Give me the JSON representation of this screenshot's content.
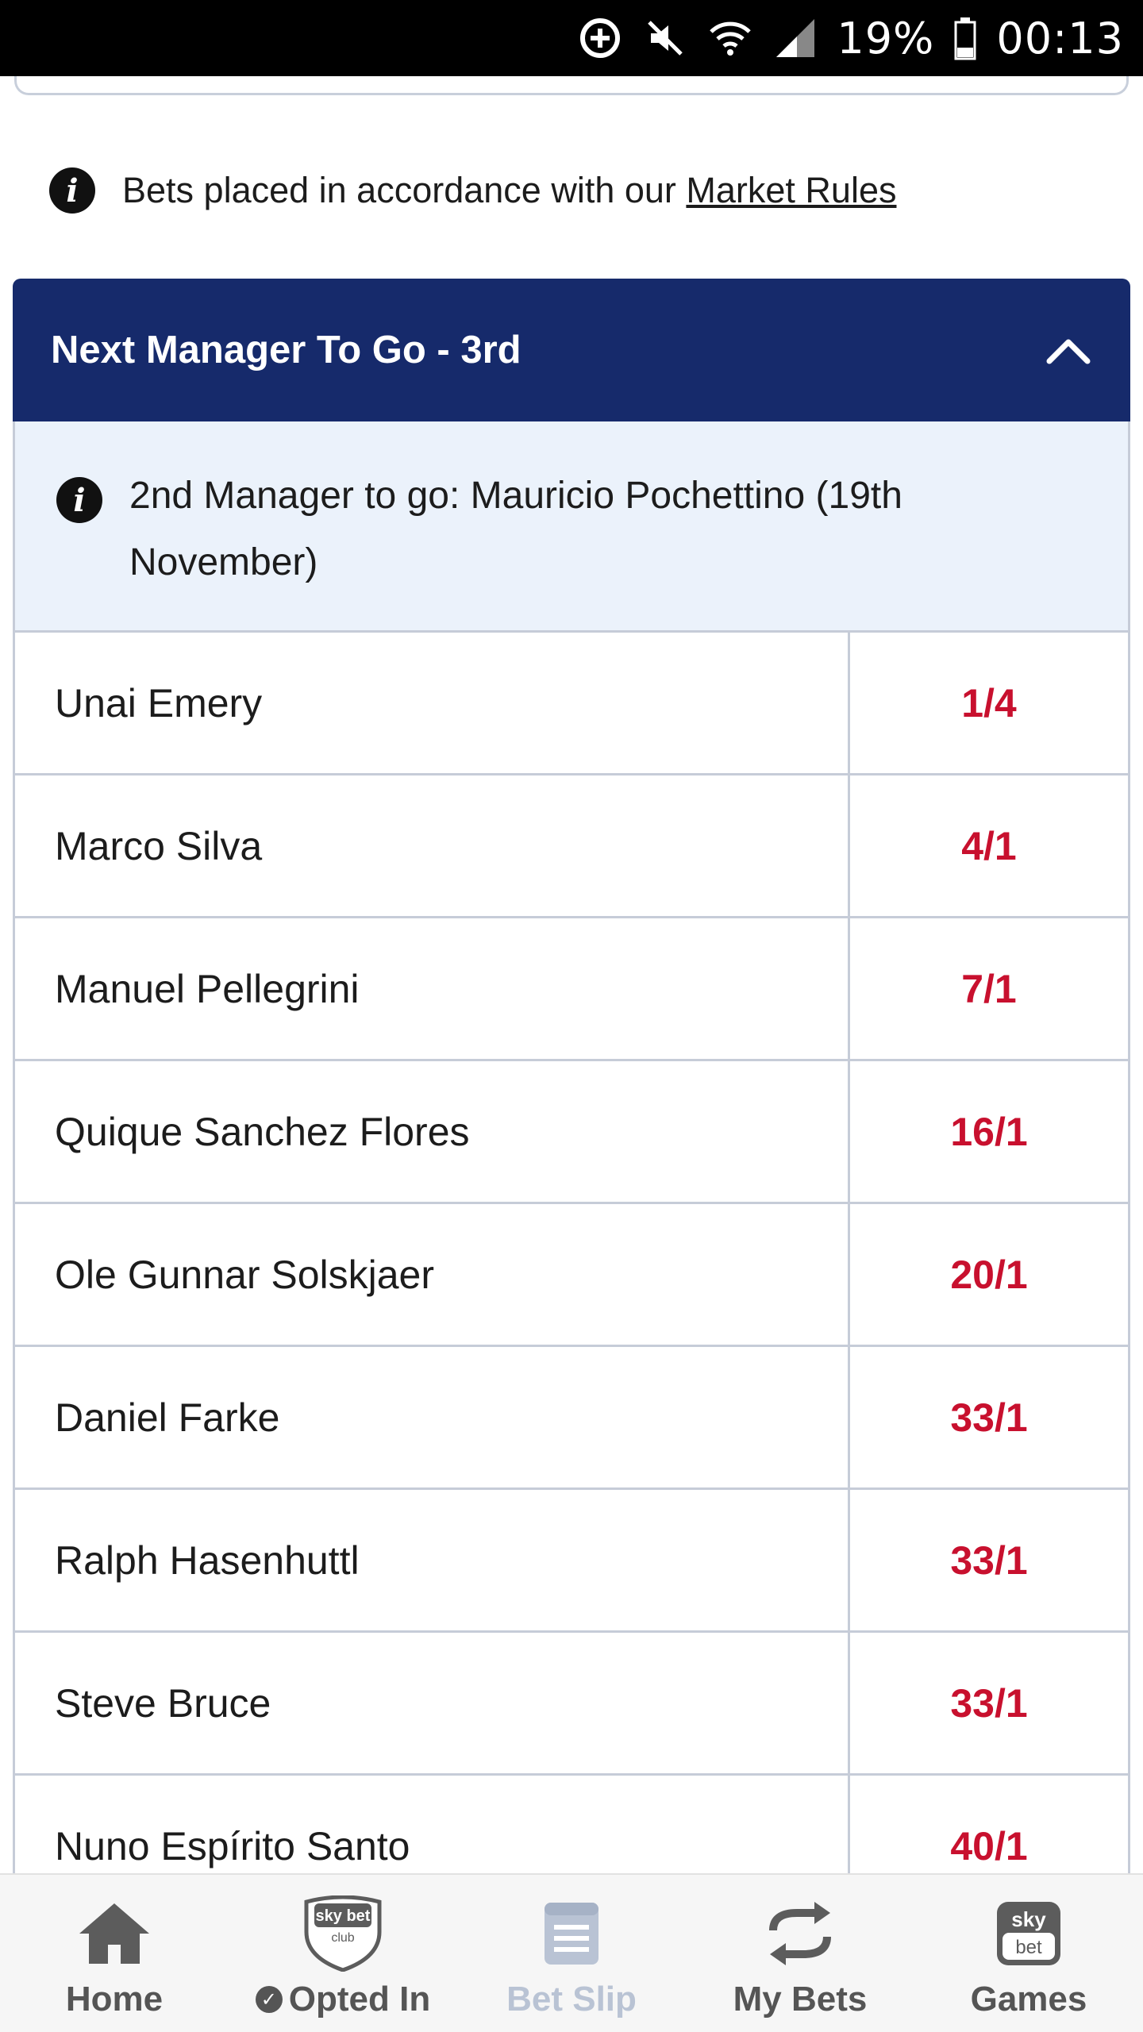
{
  "status_bar": {
    "battery": "19%",
    "time": "00:13",
    "icons": [
      "data-saver-icon",
      "mute-icon",
      "wifi-icon",
      "signal-icon",
      "battery-icon"
    ]
  },
  "info": {
    "prefix": "Bets placed in accordance with our ",
    "link": "Market Rules"
  },
  "market": {
    "title": "Next Manager To Go - 3rd",
    "note": "2nd Manager to go: Mauricio Pochettino (19th November)",
    "rows": [
      {
        "name": "Unai Emery",
        "odds": "1/4"
      },
      {
        "name": "Marco Silva",
        "odds": "4/1"
      },
      {
        "name": "Manuel Pellegrini",
        "odds": "7/1"
      },
      {
        "name": "Quique Sanchez Flores",
        "odds": "16/1"
      },
      {
        "name": "Ole Gunnar Solskjaer",
        "odds": "20/1"
      },
      {
        "name": "Daniel Farke",
        "odds": "33/1"
      },
      {
        "name": "Ralph Hasenhuttl",
        "odds": "33/1"
      },
      {
        "name": "Steve Bruce",
        "odds": "33/1"
      },
      {
        "name": "Nuno Espírito Santo",
        "odds": "40/1"
      }
    ]
  },
  "nav": {
    "home": "Home",
    "club": "Opted In",
    "club_badge_top": "sky bet",
    "club_badge_bottom": "club",
    "betslip": "Bet Slip",
    "mybets": "My Bets",
    "games": "Games",
    "games_badge_top": "sky",
    "games_badge_bottom": "bet"
  },
  "colors": {
    "header_bg": "#162a6b",
    "odds": "#c8102e",
    "note_bg": "#ebf2fb"
  }
}
